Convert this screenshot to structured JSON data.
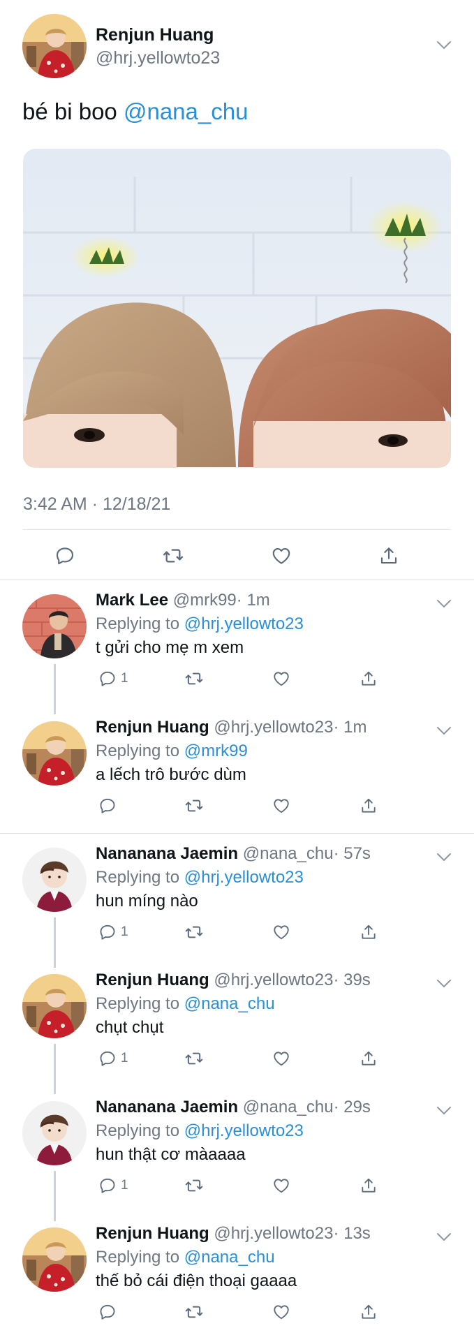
{
  "main_tweet": {
    "author_name": "Renjun Huang",
    "author_handle": "@hrj.yellowto23",
    "text": "bé bi boo ",
    "mention": "@nana_chu",
    "timestamp": "3:42 AM · 12/18/21"
  },
  "replies": [
    {
      "name": "Mark Lee",
      "handle": "@mrk99",
      "time": "· 1m",
      "replying_label": "Replying to ",
      "replying_to": "@hrj.yellowto23",
      "text": "t gửi cho mẹ m xem",
      "reply_count": "1",
      "avatar": "mark"
    },
    {
      "name": "Renjun Huang",
      "handle": "@hrj.yellowto23",
      "time": "· 1m",
      "replying_label": "Replying to ",
      "replying_to": "@mrk99",
      "text": "a lếch trô bước dùm",
      "reply_count": "",
      "avatar": "renjun"
    },
    {
      "name": "Nananana Jaemin",
      "handle": "@nana_chu",
      "time": "· 57s",
      "replying_label": "Replying to ",
      "replying_to": "@hrj.yellowto23",
      "text": "hun míng nào",
      "reply_count": "1",
      "avatar": "jaemin"
    },
    {
      "name": "Renjun Huang",
      "handle": "@hrj.yellowto23",
      "time": "· 39s",
      "replying_label": "Replying to ",
      "replying_to": "@nana_chu",
      "text": "chụt chụt",
      "reply_count": "1",
      "avatar": "renjun"
    },
    {
      "name": "Nananana Jaemin",
      "handle": "@nana_chu",
      "time": "· 29s",
      "replying_label": "Replying to ",
      "replying_to": "@hrj.yellowto23",
      "text": "hun thật cơ màaaaa",
      "reply_count": "1",
      "avatar": "jaemin"
    },
    {
      "name": "Renjun Huang",
      "handle": "@hrj.yellowto23",
      "time": "· 13s",
      "replying_label": "Replying to ",
      "replying_to": "@nana_chu",
      "text": "thế bỏ cái điện thoại gaaaa",
      "reply_count": "",
      "avatar": "renjun"
    }
  ],
  "colors": {
    "link": "#2a8fd6",
    "muted": "#6e7681",
    "icon": "#5b6b7a"
  },
  "icons": [
    "reply-icon",
    "retweet-icon",
    "like-icon",
    "share-icon",
    "chevron-down-icon"
  ]
}
